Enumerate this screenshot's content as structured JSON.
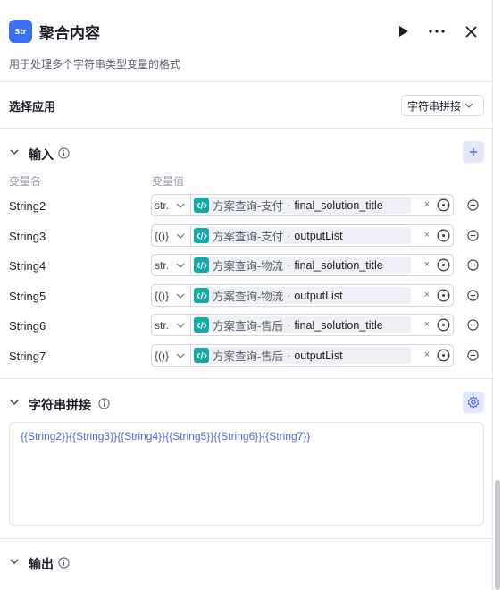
{
  "header": {
    "logo_text": "Str",
    "title": "聚合内容",
    "description": "用于处理多个字符串类型变量的格式",
    "actions": [
      "run-icon",
      "more-icon",
      "close-icon"
    ]
  },
  "app_select": {
    "label": "选择应用",
    "value": "字符串拼接"
  },
  "input_section": {
    "title": "输入",
    "col_name": "变量名",
    "col_value": "变量值",
    "rows": [
      {
        "name": "String2",
        "type": "str.",
        "node": "方案查询-支付",
        "sep": "·",
        "var": "final_solution_title",
        "clear": "×"
      },
      {
        "name": "String3",
        "type": "{()}",
        "node": "方案查询-支付",
        "sep": "·",
        "var": "outputList",
        "clear": "×"
      },
      {
        "name": "String4",
        "type": "str.",
        "node": "方案查询-物流",
        "sep": "·",
        "var": "final_solution_title",
        "clear": "×"
      },
      {
        "name": "String5",
        "type": "{()}",
        "node": "方案查询-物流",
        "sep": "·",
        "var": "outputList",
        "clear": "×"
      },
      {
        "name": "String6",
        "type": "str.",
        "node": "方案查询-售后",
        "sep": "·",
        "var": "final_solution_title",
        "clear": "×"
      },
      {
        "name": "String7",
        "type": "{()}",
        "node": "方案查询-售后",
        "sep": "·",
        "var": "outputList",
        "clear": "×"
      }
    ]
  },
  "concat_section": {
    "title": "字符串拼接",
    "template": "{{String2}}{{String3}}{{String4}}{{String5}}{{String6}}{{String7}}"
  },
  "output_section": {
    "title": "输出"
  },
  "colors": {
    "accent": "#3b6ff5",
    "ref_icon": "#17a8a8",
    "template_text": "#4b6bd6",
    "button_bg": "#e4e7fb"
  }
}
